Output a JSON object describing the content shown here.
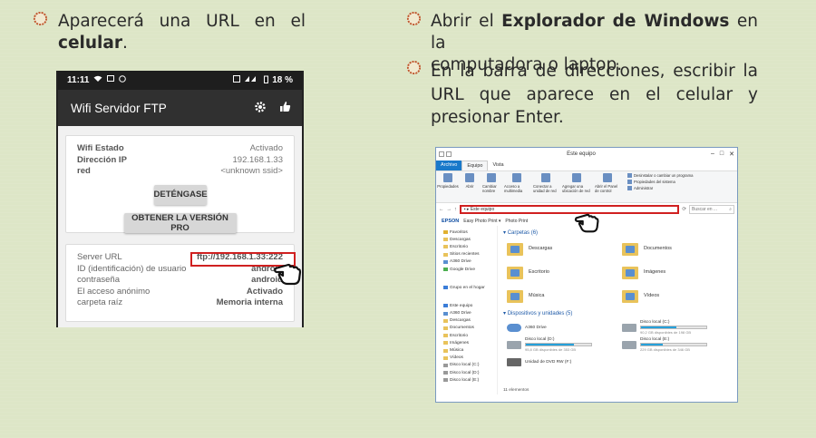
{
  "left_text": {
    "line1": "Aparecerá una URL en el",
    "line2_bold": "celular",
    "line2_tail": "."
  },
  "right_text": {
    "item1_pre": "Abrir el",
    "item1_bold": "Explorador de Windows",
    "item1_post": "en la",
    "item1_line2": "computadora o laptop.",
    "item2": "En la barra de direcciones, escribir la URL que aparece en el celular y presionar Enter."
  },
  "phone": {
    "status_time": "11:11",
    "battery": "18 %",
    "app_title": "Wifi Servidor FTP",
    "card1": [
      {
        "k": "Wifi Estado",
        "v": "Activado"
      },
      {
        "k": "Dirección IP",
        "v": "192.168.1.33"
      },
      {
        "k": "red",
        "v": "<unknown ssid>"
      }
    ],
    "stop_label": "DETÉNGASE",
    "pro_label": "OBTENER LA VERSIÓN PRO",
    "card2": [
      {
        "k": "Server URL",
        "v": "ftp://192.168.1.33:222"
      },
      {
        "k": "ID (identificación) de usuario",
        "v": "android"
      },
      {
        "k": "contraseña",
        "v": "android"
      },
      {
        "k": "El acceso anónimo",
        "v": "Activado"
      },
      {
        "k": "carpeta raíz",
        "v": "Memoria interna"
      }
    ]
  },
  "explorer": {
    "title": "Este equipo",
    "tabs": [
      "Archivo",
      "Equipo",
      "Vista"
    ],
    "ribbon_buttons": [
      "Propiedades",
      "Abrir",
      "Cambiar nombre",
      "Acceso a multimedia",
      "Conectar a unidad de red",
      "Agregar una ubicación de red",
      "Abrir el Panel de control"
    ],
    "ribbon_list": [
      "Desinstalar o cambiar un programa",
      "Propiedades del sistema",
      "Administrar"
    ],
    "address": "Este equipo",
    "search_placeholder": "Buscar en ...",
    "menu": [
      "EPSON",
      "Easy Photo Print ▾",
      "Photo Print"
    ],
    "nav_items": [
      "Favoritos",
      "Descargas",
      "Escritorio",
      "Sitios recientes",
      "A360 Drive",
      "Google Drive",
      "",
      "Grupo en el hogar",
      "",
      "Este equipo",
      "A360 Drive",
      "Descargas",
      "Documentos",
      "Escritorio",
      "Imágenes",
      "Música",
      "Vídeos",
      "Disco local (C:)",
      "Disco local (D:)",
      "Disco local (E:)"
    ],
    "section_folders": "Carpetas (6)",
    "folders": [
      "Descargas",
      "Documentos",
      "Escritorio",
      "Imágenes",
      "Música",
      "Vídeos"
    ],
    "section_devices": "Dispositivos y unidades (5)",
    "drives": [
      {
        "name": "A360 Drive",
        "detail": "",
        "used": 0
      },
      {
        "name": "Disco local (C:)",
        "detail": "90,2 GB disponibles de 198 GB",
        "used": 0.54
      },
      {
        "name": "Disco local (D:)",
        "detail": "95,8 GB disponibles de 353 GB",
        "used": 0.73
      },
      {
        "name": "Disco local (E:)",
        "detail": "229 GB disponibles de 346 GB",
        "used": 0.34
      },
      {
        "name": "Unidad de DVD RW (F:)",
        "detail": "",
        "used": 0
      }
    ],
    "status": "11 elementos"
  },
  "colors": {
    "background": "#dde6c7",
    "bullet": "#c0552d",
    "highlight": "#d02020"
  }
}
